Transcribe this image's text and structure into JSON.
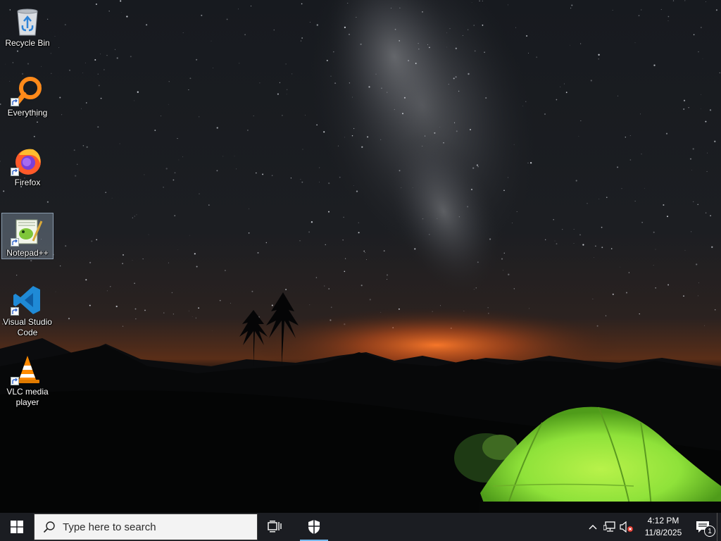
{
  "desktop": {
    "icons": [
      {
        "label": "Recycle Bin",
        "icon": "recycle-bin-icon",
        "shortcut": false
      },
      {
        "label": "Everything",
        "icon": "everything-search-icon",
        "shortcut": true
      },
      {
        "label": "Firefox",
        "icon": "firefox-icon",
        "shortcut": true
      },
      {
        "label": "Notepad++",
        "icon": "notepad-plus-plus-icon",
        "shortcut": true,
        "selected": true
      },
      {
        "label": "Visual Studio Code",
        "icon": "vscode-icon",
        "shortcut": true
      },
      {
        "label": "VLC media player",
        "icon": "vlc-icon",
        "shortcut": true
      }
    ]
  },
  "taskbar": {
    "search_placeholder": "Type here to search",
    "pinned": [
      {
        "name": "task-view-icon"
      },
      {
        "name": "windows-security-icon",
        "active": true
      }
    ],
    "tray": {
      "icons": [
        "chevron-up-icon",
        "network-icon",
        "volume-muted-icon"
      ],
      "time": "4:12 PM",
      "date": "11/8/2025",
      "notification_count": "1"
    }
  },
  "colors": {
    "taskbar_bg": "#1b1d22",
    "accent": "#76b9ed",
    "tent_green": "#8fe23a",
    "horizon_glow": "#ff7a2a"
  }
}
